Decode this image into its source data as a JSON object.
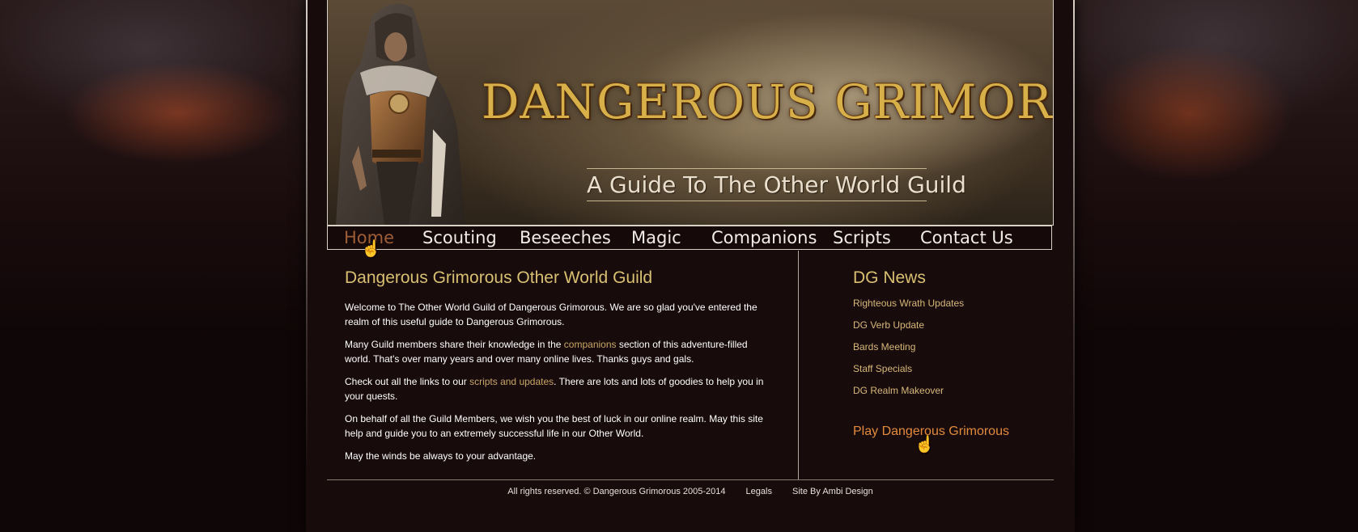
{
  "banner": {
    "title": "DANGEROUS GRIMOROUS",
    "subtitle": "A Guide To The Other World Guild"
  },
  "nav": {
    "items": [
      {
        "label": "Home",
        "active": true
      },
      {
        "label": "Scouting"
      },
      {
        "label": "Beseeches"
      },
      {
        "label": "Magic"
      },
      {
        "label": "Companions"
      },
      {
        "label": "Scripts"
      },
      {
        "label": "Contact Us"
      }
    ]
  },
  "main": {
    "heading": "Dangerous Grimorous Other World Guild",
    "p1": "Welcome to The Other World Guild of Dangerous Grimorous. We are so glad you've entered the realm of this useful guide to Dangerous Grimorous.",
    "p2_before": "Many Guild members share their knowledge in the ",
    "p2_link": "companions",
    "p2_after": " section of this adventure-filled world. That's over many years and over many online lives. Thanks guys and gals.",
    "p3_before": "Check out all the links to our ",
    "p3_link": "scripts and updates",
    "p3_after": ". There are lots and lots of goodies to help you in your quests.",
    "p4": "On behalf of all the Guild Members, we wish you the best of luck in our online realm. May this site help and guide you to an extremely successful life in our Other World.",
    "p5": "May the winds be always to your advantage."
  },
  "sidebar": {
    "heading": "DG News",
    "news": [
      "Righteous Wrath Updates",
      "DG Verb Update",
      "Bards Meeting",
      "Staff Specials",
      "DG Realm Makeover"
    ],
    "play_link": "Play Dangerous Grimorous"
  },
  "footer": {
    "copyright": "All rights reserved. © Dangerous Grimorous 2005-2014",
    "legals": "Legals",
    "credit": "Site By Ambi Design"
  },
  "colors": {
    "heading_gold": "#d8c070",
    "link_tan": "#c8a664",
    "play_orange": "#e28a3a",
    "nav_active": "#9d5e35",
    "page_bg": "#170b0c"
  },
  "icons": {
    "cursor": "hand-pointer-icon"
  }
}
